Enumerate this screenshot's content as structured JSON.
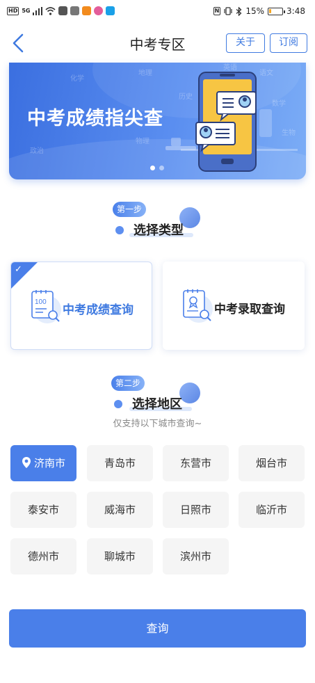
{
  "status_bar": {
    "network_left": "HD",
    "network_5g": "5G",
    "battery_percent": "15%",
    "battery_level": 0.15,
    "time": "3:48"
  },
  "header": {
    "title": "中考专区",
    "about_label": "关于",
    "subscribe_label": "订阅"
  },
  "banner": {
    "title": "中考成绩指尖查",
    "watermarks": [
      "化学",
      "地理",
      "英语",
      "语文",
      "数学",
      "历史",
      "物理",
      "生物",
      "政治"
    ],
    "slide_count": 2,
    "active_slide": 1
  },
  "step1": {
    "badge": "第一步",
    "title": "选择类型"
  },
  "query_types": [
    {
      "label": "中考成绩查询",
      "icon_text": "100",
      "selected": true
    },
    {
      "label": "中考录取查询",
      "selected": false
    }
  ],
  "step2": {
    "badge": "第二步",
    "title": "选择地区",
    "hint": "仅支持以下城市查询~"
  },
  "cities": [
    "济南市",
    "青岛市",
    "东营市",
    "烟台市",
    "泰安市",
    "威海市",
    "日照市",
    "临沂市",
    "德州市",
    "聊城市",
    "滨州市"
  ],
  "selected_city": "济南市",
  "query_button": "查询",
  "colors": {
    "accent": "#4a7fe9",
    "accent_dark": "#3f7ae0",
    "city_bg": "#f5f5f5"
  }
}
